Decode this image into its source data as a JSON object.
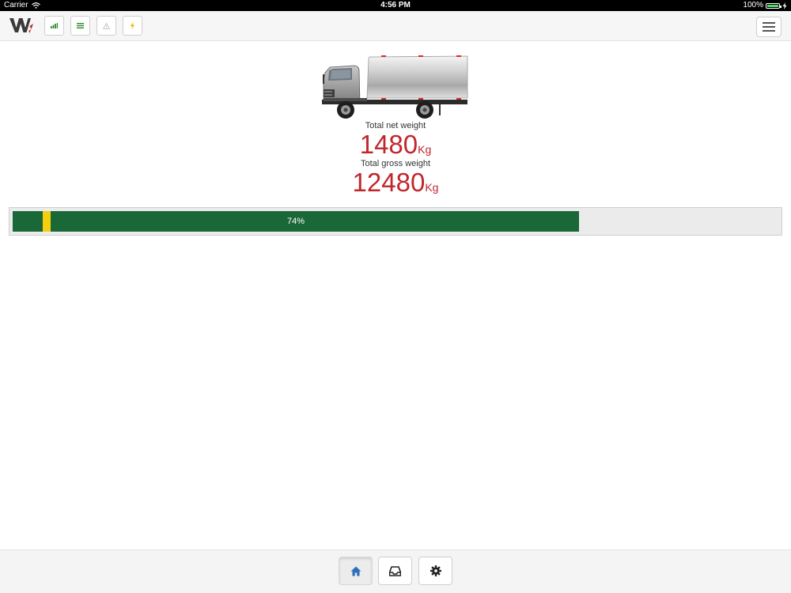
{
  "status_bar": {
    "carrier": "Carrier",
    "time": "4:56 PM",
    "battery": "100%"
  },
  "toolbar": {
    "icons": [
      "signal-bars-icon",
      "list-lines-icon",
      "warning-triangle-icon",
      "lightning-bolt-icon"
    ],
    "colors": {
      "green": "#2e8b2e",
      "yellow": "#f0b400",
      "grey": "#bbbbbb"
    }
  },
  "summary": {
    "net_label": "Total net weight",
    "net_value": "1480",
    "net_unit": "Kg",
    "gross_label": "Total gross weight",
    "gross_value": "12480",
    "gross_unit": "Kg"
  },
  "load": {
    "percent_value": 0.74,
    "percent_text": "74%",
    "bar_color": "#1a6737",
    "marker_color": "#f5cf0f"
  },
  "tabs": [
    {
      "icon": "home-icon",
      "active": true
    },
    {
      "icon": "inbox-icon",
      "active": false
    },
    {
      "icon": "gear-icon",
      "active": false
    }
  ],
  "accent_color": "#c0272d"
}
